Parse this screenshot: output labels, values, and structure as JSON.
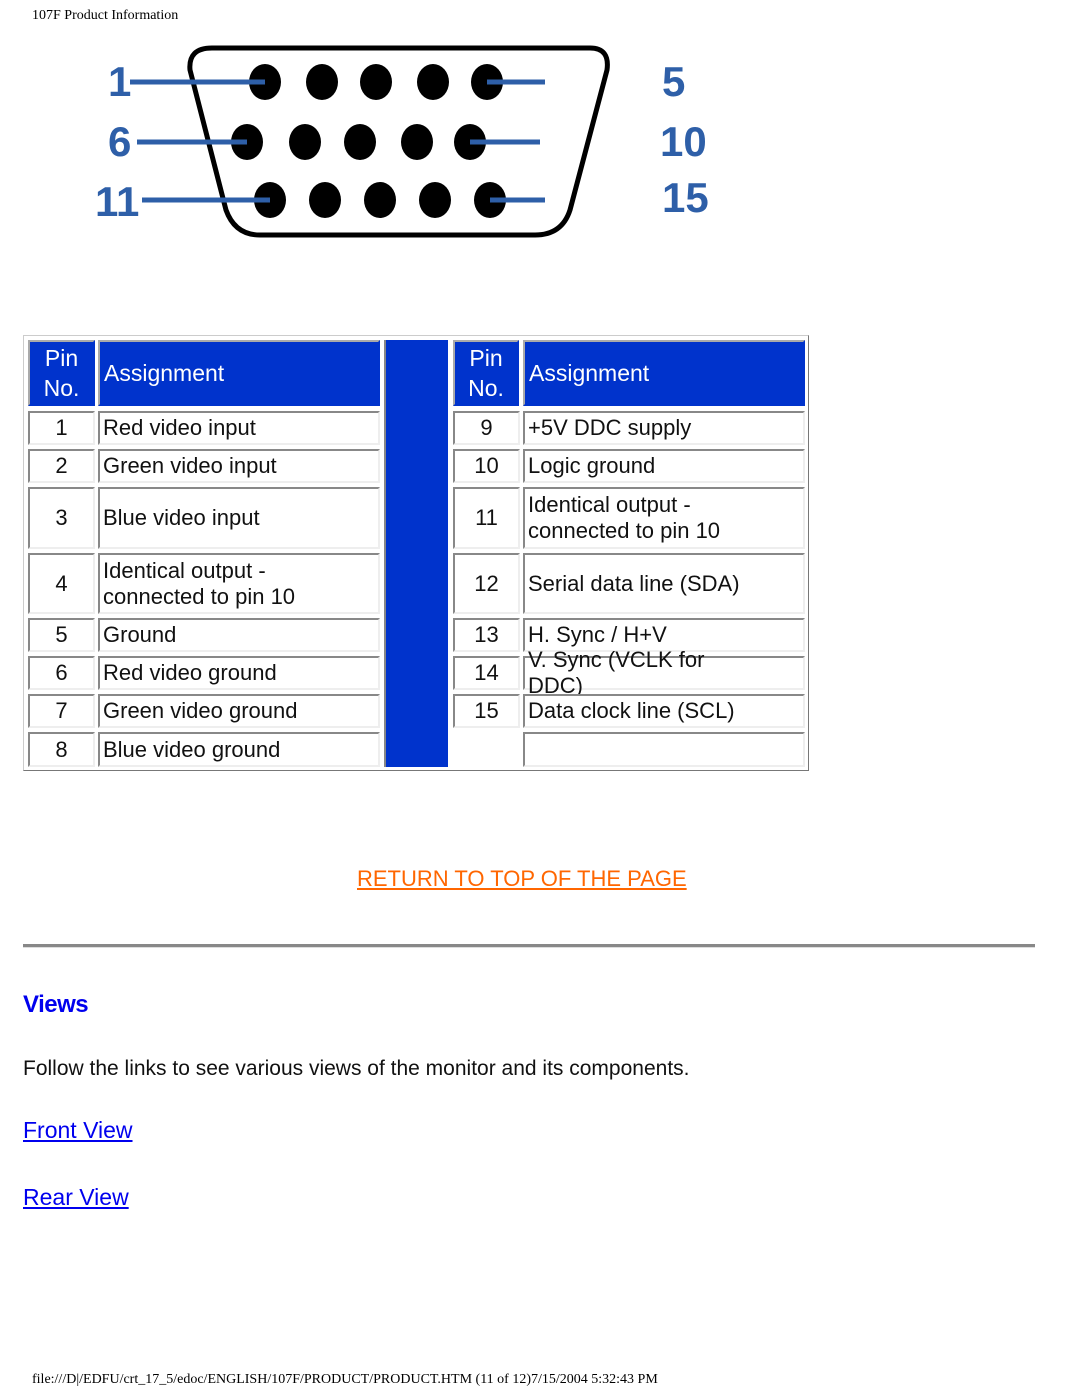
{
  "page_header": "107F Product Information",
  "connector_diagram": {
    "labels": [
      "1",
      "5",
      "6",
      "10",
      "11",
      "15"
    ],
    "colors": {
      "label": "#2e5fa8",
      "pin": "#000000",
      "outline": "#000000"
    }
  },
  "pin_table": {
    "header": {
      "pin": [
        "Pin",
        "No."
      ],
      "assignment": "Assignment"
    },
    "colors": {
      "header_bg": "#0033cc",
      "header_text": "#ffffff"
    },
    "left_rows": [
      {
        "pin": "1",
        "assignment": "Red video input"
      },
      {
        "pin": "2",
        "assignment": "Green video input"
      },
      {
        "pin": "3",
        "assignment": "Blue video input"
      },
      {
        "pin": "4",
        "assignment": "Identical output - connected to pin 10"
      },
      {
        "pin": "5",
        "assignment": "Ground"
      },
      {
        "pin": "6",
        "assignment": "Red video ground"
      },
      {
        "pin": "7",
        "assignment": "Green video ground"
      },
      {
        "pin": "8",
        "assignment": "Blue video ground"
      }
    ],
    "right_rows": [
      {
        "pin": "9",
        "assignment": "+5V DDC supply"
      },
      {
        "pin": "10",
        "assignment": "Logic ground"
      },
      {
        "pin": "11",
        "assignment": "Identical output - connected to pin 10"
      },
      {
        "pin": "12",
        "assignment": "Serial data line (SDA)"
      },
      {
        "pin": "13",
        "assignment": "H. Sync / H+V"
      },
      {
        "pin": "14",
        "assignment": "V. Sync (VCLK for DDC)"
      },
      {
        "pin": "15",
        "assignment": "Data clock line (SCL)"
      },
      {
        "pin": "",
        "assignment": ""
      }
    ]
  },
  "return_link": {
    "label": "RETURN TO TOP OF THE PAGE",
    "color": "#ff6600"
  },
  "views": {
    "heading": "Views",
    "description": "Follow the links to see various views of the monitor and its components.",
    "links": [
      {
        "label": "Front View"
      },
      {
        "label": "Rear View"
      }
    ],
    "link_color": "#0000ee"
  },
  "page_footer": "file:///D|/EDFU/crt_17_5/edoc/ENGLISH/107F/PRODUCT/PRODUCT.HTM (11 of 12)7/15/2004 5:32:43 PM"
}
